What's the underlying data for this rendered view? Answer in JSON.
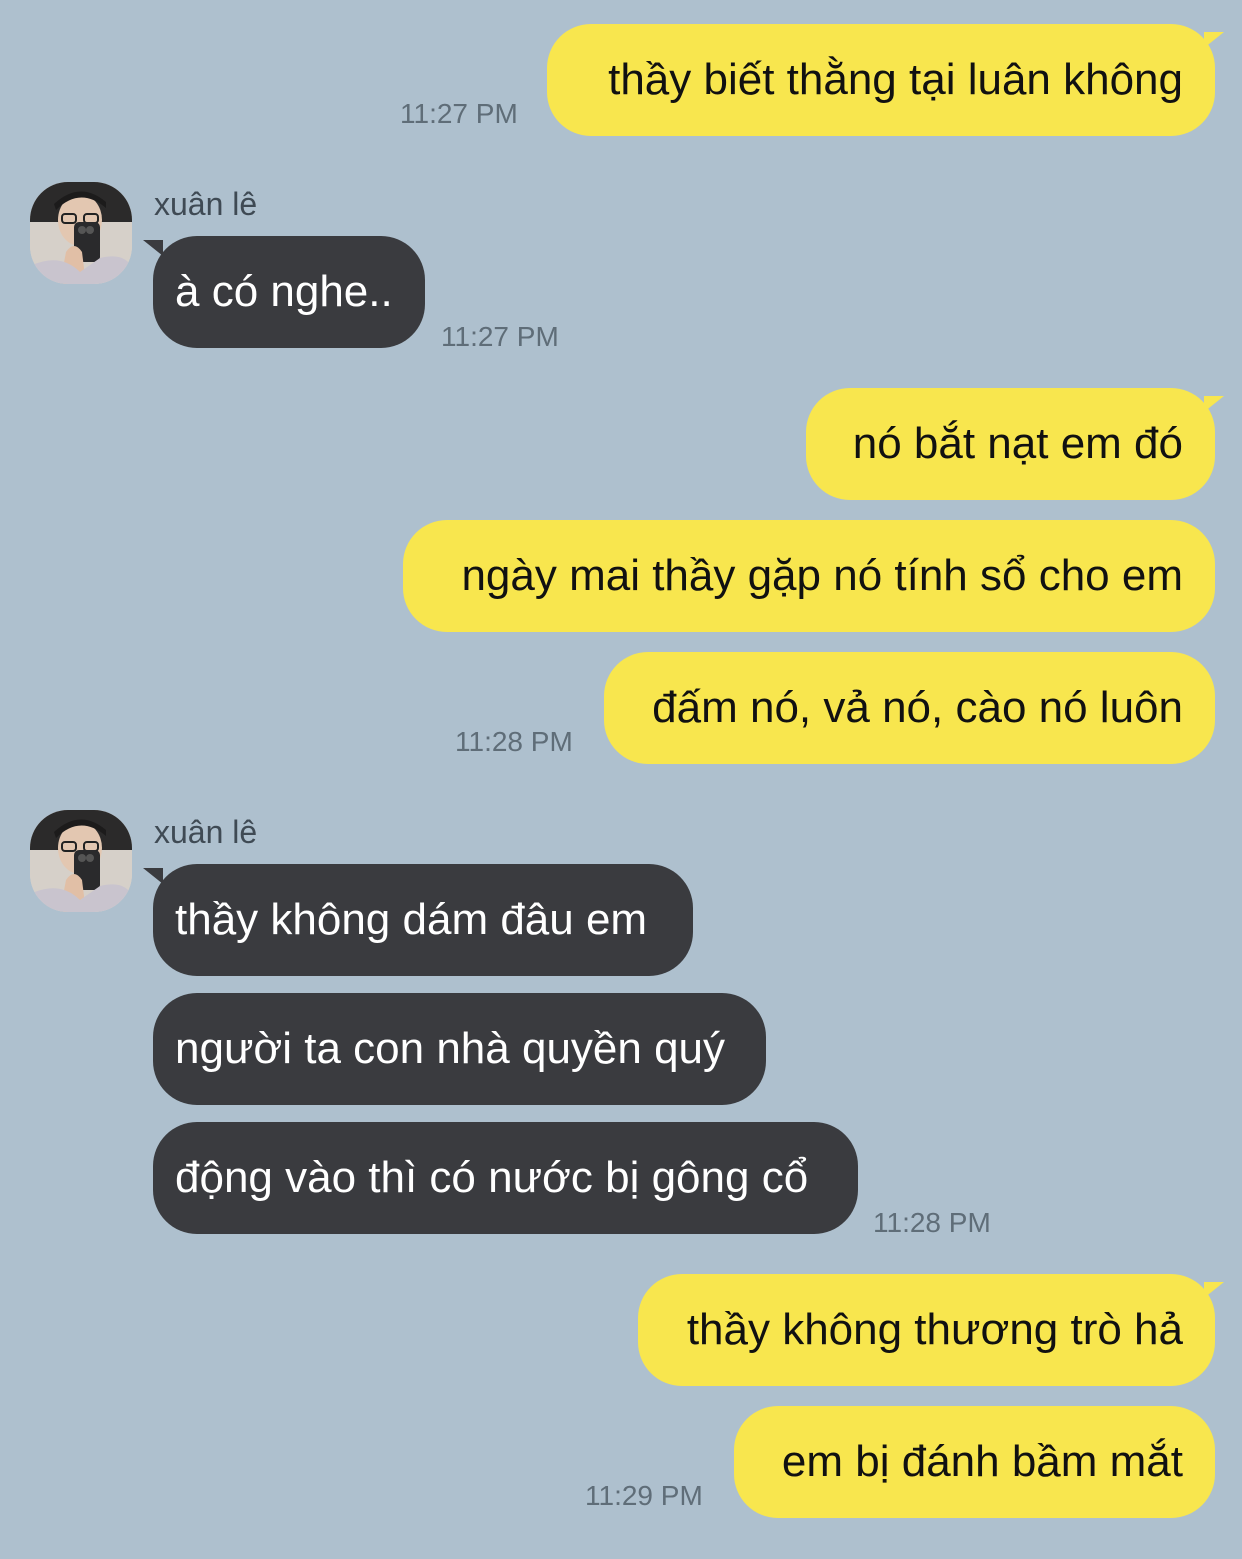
{
  "chat": {
    "sender_name": "xuân lê",
    "messages": [
      {
        "id": 1,
        "text": "thầy biết thằng tại luân không"
      },
      {
        "id": 2,
        "text": "à có nghe.."
      },
      {
        "id": 3,
        "text": "nó bắt nạt em đó"
      },
      {
        "id": 4,
        "text": "ngày mai thầy gặp nó tính sổ cho em"
      },
      {
        "id": 5,
        "text": "đấm nó, vả nó, cào nó luôn"
      },
      {
        "id": 6,
        "text": "thầy không dám đâu em"
      },
      {
        "id": 7,
        "text": "người ta con nhà quyền quý"
      },
      {
        "id": 8,
        "text": "động vào thì có nước bị gông cổ"
      },
      {
        "id": 9,
        "text": "thầy không thương trò hả"
      },
      {
        "id": 10,
        "text": "em bị đánh bầm mắt"
      }
    ],
    "timestamps": [
      "11:27 PM",
      "11:27 PM",
      "11:28 PM",
      "11:28 PM",
      "11:29 PM"
    ]
  },
  "colors": {
    "background": "#aec0ce",
    "outgoing_bubble": "#f8e64e",
    "incoming_bubble": "#3a3b3f",
    "timestamp_text": "#5f6d78"
  },
  "icons": {
    "avatar": "avatar-photo"
  }
}
